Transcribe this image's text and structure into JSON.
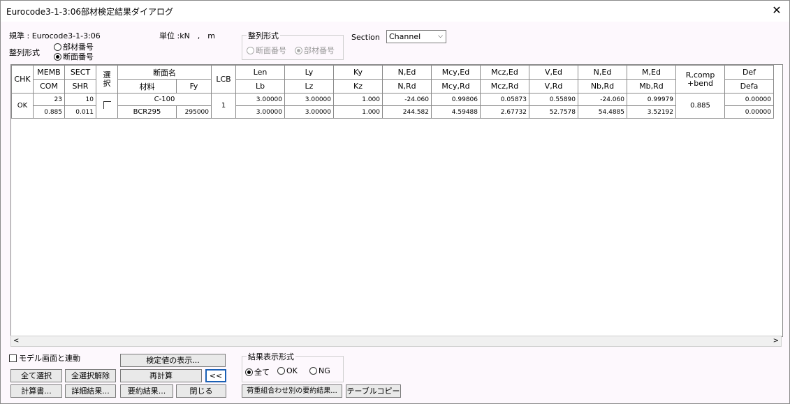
{
  "window": {
    "title": "Eurocode3-1-3:06部材検定結果ダイアログ",
    "close_label": "✕"
  },
  "header": {
    "standard": "規準 : Eurocode3-1-3:06",
    "unit": "単位 :kN　,　m",
    "sort_label": "整列形式",
    "sort_options": [
      "部材番号",
      "断面番号"
    ],
    "sort_selected": 1,
    "sort_group": {
      "label": "整列形式",
      "options": [
        "断面番号",
        "部材番号"
      ],
      "selected": 1
    },
    "section_label": "Section",
    "section_value": "Channel"
  },
  "table": {
    "head_top": [
      "CHK",
      "MEMB",
      "SECT",
      "選択",
      "断面名",
      "LCB",
      "Len",
      "Ly",
      "Ky",
      "N,Ed",
      "Mcy,Ed",
      "Mcz,Ed",
      "V,Ed",
      "N,Ed",
      "M,Ed",
      "R,comp\n+bend",
      "Def"
    ],
    "head_bottom": [
      "COM",
      "SHR",
      "材料",
      "Fy",
      "Lb",
      "Lz",
      "Kz",
      "N,Rd",
      "Mcy,Rd",
      "Mcz,Rd",
      "V,Rd",
      "Nb,Rd",
      "Mb,Rd",
      "Defa"
    ],
    "rows": [
      {
        "chk": "OK",
        "memb": "23",
        "sect": "10",
        "section_name": "C-100",
        "lcb": "1",
        "len": "3.00000",
        "ly": "3.00000",
        "ky": "1.000",
        "n_ed": "-24.060",
        "mcy_ed": "0.99806",
        "mcz_ed": "0.05873",
        "v_ed": "0.55890",
        "n_ed2": "-24.060",
        "m_ed": "0.99979",
        "r_comp": "0.885",
        "def": "0.00000",
        "com": "0.885",
        "shr": "0.011",
        "material": "BCR295",
        "fy": "295000",
        "lb": "3.00000",
        "lz": "3.00000",
        "kz": "1.000",
        "n_rd": "244.582",
        "mcy_rd": "4.59488",
        "mcz_rd": "2.67732",
        "v_rd": "52.7578",
        "nb_rd": "54.4885",
        "mb_rd": "3.52192",
        "defa": "0.00000"
      }
    ]
  },
  "footer": {
    "link_model": "モデル画面と連動",
    "show_values": "検定値の表示...",
    "select_all": "全て選択",
    "deselect_all": "全選択解除",
    "recalc": "再計算",
    "collapse": "<<",
    "calc_sheet": "計算書...",
    "detail": "詳細結果...",
    "summary": "要約結果...",
    "close": "閉じる",
    "result_group": {
      "label": "結果表示形式",
      "options": [
        "全て",
        "OK",
        "NG"
      ],
      "selected": 0
    },
    "load_comb_summary": "荷重組合わせ別の要約結果...",
    "table_copy": "テーブルコピー"
  }
}
